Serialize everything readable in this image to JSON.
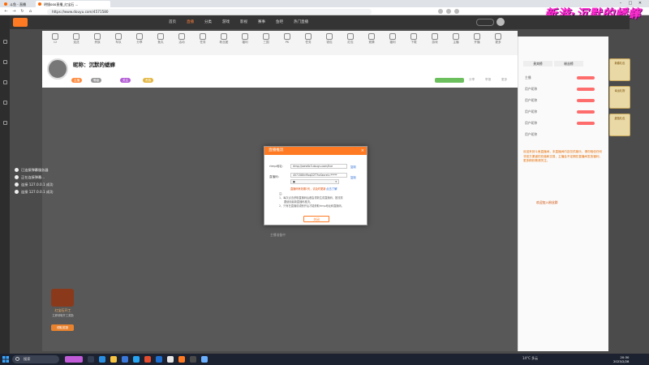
{
  "browser": {
    "tabs": [
      {
        "label": "斗鱼 - 直播"
      },
      {
        "label": "明镜ooo直播_红宝石 ..."
      }
    ],
    "url": "https://www.douyu.com/4571580"
  },
  "overlay_title": "新游·沉默的蟋蟀",
  "site_nav": {
    "items": [
      "首页",
      "直播",
      "分类",
      "游戏",
      "影视",
      "赛事",
      "鱼吧",
      "热门直播"
    ],
    "hot_index": 2
  },
  "toolbar_icons": [
    "12",
    "连送",
    "贵族",
    "车队",
    "分享",
    "鱼丸",
    "活动",
    "任务",
    "粉丝团",
    "福利",
    "三国",
    "PK",
    "任务",
    "钱包",
    "红包",
    "竞猜",
    "福利",
    "下载",
    "游戏",
    "主播",
    "开播",
    "更多"
  ],
  "room": {
    "title": "昵称：沉默的蟋蟀",
    "tags": [
      "主播",
      "等级",
      "关注",
      "贵族"
    ],
    "sublinks": [
      "分享",
      "举报",
      "更多"
    ]
  },
  "video_label": "主播准备中",
  "notifications": [
    "已连接弹幕服务器",
    "正在连接弹幕...",
    "连接 127.0.0.1 成功",
    "连接 127.0.0.1 成功"
  ],
  "promo": {
    "title": "红宝石开工",
    "subtitle": "立即领取开工奖励",
    "button": "领取奖励"
  },
  "right_panel": {
    "rows": [
      "贵宾榜",
      "粉丝榜",
      "主播",
      "用户昵称",
      "用户昵称",
      "用户昵称",
      "用户昵称",
      "用户昵称"
    ],
    "announcement": "欢迎来到斗鱼直播间，本直播间内容仅供娱乐，请勿相信任何非官方渠道的充值和交易，主播会不定期在直播间发放福利，更多精彩敬请关注。",
    "footer": "欢迎加入粉丝群"
  },
  "gift_column": [
    "新春礼包",
    "幸运礼物",
    "超值礼包"
  ],
  "dialog": {
    "title": "直播推流",
    "rtmp_label": "rtmp地址：",
    "rtmp_value": "rtmp://sendtc3.douyu.com/live",
    "copy1": "复制",
    "key_label": "直播码：",
    "key_value": "4571580rIRcqD2T?txSecret=*****",
    "copy2": "复制",
    "select_value": "●",
    "warning": "直播码有效期3天，请及时更新",
    "learn_more": "点击了解",
    "note_heading": "注：",
    "note1": "1、每次点击获取直播码后都会重新生成直播码，推流需",
    "note1b": "要使用最新直播码推流。",
    "note2": "2、只有在直播前或断开后才能获取rtmp地址和直播码。",
    "ok": "关闭"
  },
  "taskbar": {
    "search": "搜索",
    "weather": "14°C 多云",
    "time": "20:30",
    "date": "2023/2/28"
  }
}
